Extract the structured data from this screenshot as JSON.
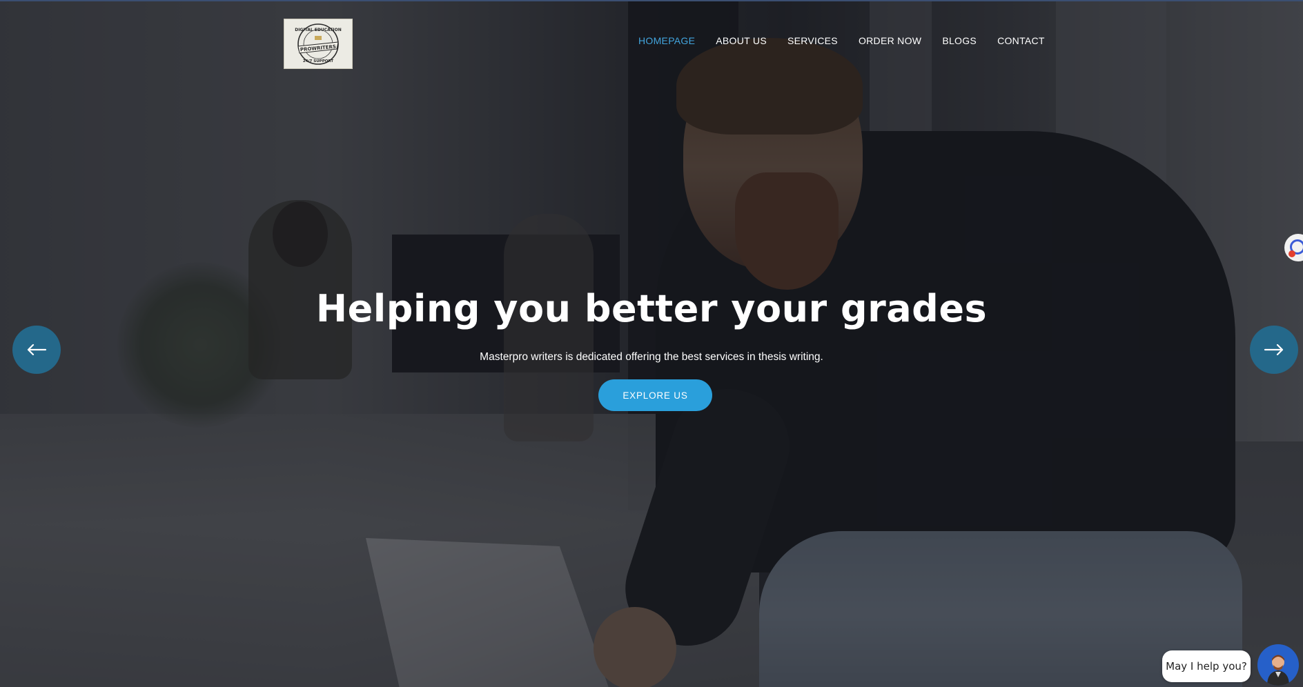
{
  "logo": {
    "top_text": "DIGITAL EDUCATION",
    "banner_text": "PROWRITERS",
    "bottom_text": "24/7 SUPPORT"
  },
  "nav": {
    "items": [
      {
        "label": "HOMEPAGE",
        "active": true
      },
      {
        "label": "ABOUT US",
        "active": false
      },
      {
        "label": "SERVICES",
        "active": false
      },
      {
        "label": "ORDER NOW",
        "active": false
      },
      {
        "label": "BLOGS",
        "active": false
      },
      {
        "label": "CONTACT",
        "active": false
      }
    ]
  },
  "hero": {
    "title": "Helping you better your grades",
    "subtitle": "Masterpro writers is dedicated offering the best services in thesis writing.",
    "cta_label": "EXPLORE US"
  },
  "slider": {
    "prev_icon": "arrow-left-icon",
    "next_icon": "arrow-right-icon"
  },
  "chat": {
    "prompt": "May I help you?",
    "avatar_icon": "support-agent-avatar"
  },
  "colors": {
    "accent": "#2a9fdb",
    "nav_active": "#42a5de",
    "arrow_bg": "#24688a",
    "chat_avatar_bg": "#2660c9"
  }
}
